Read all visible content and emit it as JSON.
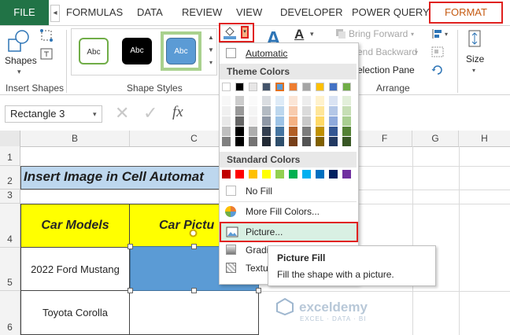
{
  "tabs": {
    "file": "FILE",
    "scroll_glyph": "◂",
    "formulas": "FORMULAS",
    "data": "DATA",
    "review": "REVIEW",
    "view": "VIEW",
    "developer": "DEVELOPER",
    "power_query": "POWER QUERY",
    "format": "FORMAT"
  },
  "ribbon": {
    "shapes_label": "Shapes",
    "insert_shapes_group": "Insert Shapes",
    "shape_styles_group": "Shape Styles",
    "style_samples": [
      "Abc",
      "Abc",
      "Abc"
    ],
    "bring_forward": "Bring Forward",
    "send_backward": "end Backward",
    "selection_pane": "election Pane",
    "arrange_group": "Arrange",
    "size_label": "Size"
  },
  "formula_bar": {
    "name_box": "Rectangle 3",
    "fx": "fx"
  },
  "sheet": {
    "columns": [
      "B",
      "C",
      "F",
      "G",
      "H"
    ],
    "rows": [
      "1",
      "2",
      "3",
      "4",
      "5",
      "6"
    ],
    "title": "Insert Image in Cell Automat",
    "header_car_models": "Car Models",
    "header_car_picture": "Car Pictu",
    "car1": "2022 Ford Mustang",
    "car2": "Toyota Corolla",
    "watermark_name": "exceldemy",
    "watermark_tag": "EXCEL · DATA · BI"
  },
  "fill_menu": {
    "automatic": "Automatic",
    "theme_colors_header": "Theme Colors",
    "standard_colors_header": "Standard Colors",
    "no_fill": "No Fill",
    "more_fill_colors": "More Fill Colors...",
    "picture": "Picture...",
    "gradient": "Gradi",
    "texture": "Textu",
    "theme_top_row": [
      "#ffffff",
      "#000000",
      "#e7e6e6",
      "#44546a",
      "#5b9bd5",
      "#ed7d31",
      "#a5a5a5",
      "#ffc000",
      "#4472c4",
      "#70ad47"
    ],
    "standard_colors": [
      "#c00000",
      "#ff0000",
      "#ffc000",
      "#ffff00",
      "#92d050",
      "#00b050",
      "#00b0f0",
      "#0070c0",
      "#002060",
      "#7030a0"
    ]
  },
  "tooltip": {
    "title": "Picture Fill",
    "description": "Fill the shape with a picture."
  },
  "colors": {
    "excel_green": "#217346",
    "highlight_red": "#e0211f",
    "title_fill": "#bdd7ee",
    "header_fill": "#ffff00",
    "shape_fill": "#5b9bd5"
  }
}
